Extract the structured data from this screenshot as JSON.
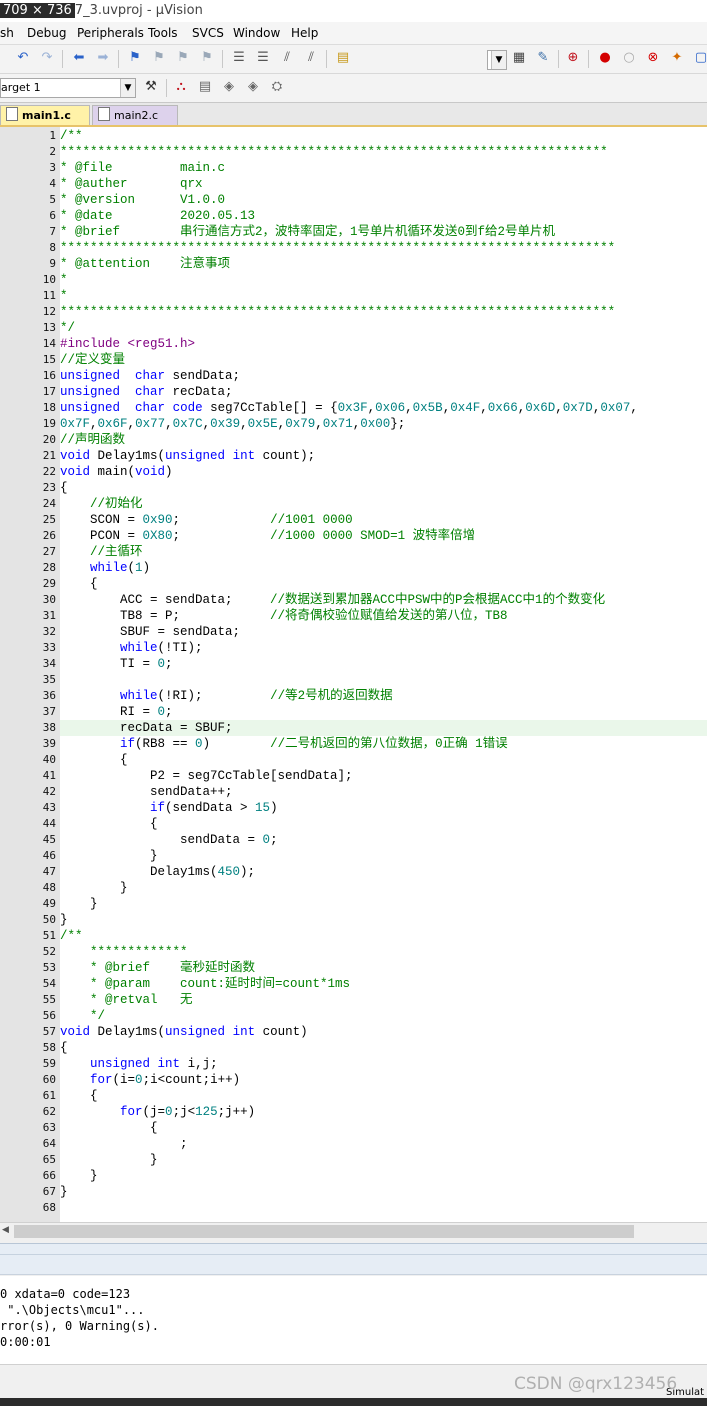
{
  "window": {
    "dimensions_label": "709 × 736",
    "title_tail": "7_3.uvproj - µVision"
  },
  "menu": [
    "sh",
    "Debug",
    "Peripherals",
    "Tools",
    "SVCS",
    "Window",
    "Help"
  ],
  "target": {
    "value": "arget 1"
  },
  "tabs": [
    {
      "label": "main1.c",
      "active": true
    },
    {
      "label": "main2.c",
      "active": false
    }
  ],
  "editor": {
    "current_line": 38,
    "lines": [
      [
        [
          "c",
          "/**"
        ]
      ],
      [
        [
          "c",
          "*************************************************************************"
        ]
      ],
      [
        [
          "c",
          "* @file         main.c"
        ]
      ],
      [
        [
          "c",
          "* @auther       qrx"
        ]
      ],
      [
        [
          "c",
          "* @version      V1.0.0"
        ]
      ],
      [
        [
          "c",
          "* @date         2020.05.13"
        ]
      ],
      [
        [
          "c",
          "* @brief        串行通信方式2，波特率固定，1号单片机循环发送0到f给2号单片机"
        ]
      ],
      [
        [
          "c",
          "**************************************************************************"
        ]
      ],
      [
        [
          "c",
          "* @attention    注意事项"
        ]
      ],
      [
        [
          "c",
          "*"
        ]
      ],
      [
        [
          "c",
          "*"
        ]
      ],
      [
        [
          "c",
          "**************************************************************************"
        ]
      ],
      [
        [
          "c",
          "*/"
        ]
      ],
      [
        [
          "p",
          "#include <reg51.h>"
        ]
      ],
      [
        [
          "c",
          "//定义变量"
        ]
      ],
      [
        [
          "k",
          "unsigned"
        ],
        [
          "",
          "  "
        ],
        [
          "k",
          "char"
        ],
        [
          "",
          " sendData;"
        ]
      ],
      [
        [
          "k",
          "unsigned"
        ],
        [
          "",
          "  "
        ],
        [
          "k",
          "char"
        ],
        [
          "",
          " recData;"
        ]
      ],
      [
        [
          "k",
          "unsigned"
        ],
        [
          "",
          "  "
        ],
        [
          "k",
          "char"
        ],
        [
          "",
          " "
        ],
        [
          "k",
          "code"
        ],
        [
          "",
          " seg7CcTable[] = {"
        ],
        [
          "n",
          "0x3F"
        ],
        [
          "",
          ","
        ],
        [
          "n",
          "0x06"
        ],
        [
          "",
          ","
        ],
        [
          "n",
          "0x5B"
        ],
        [
          "",
          ","
        ],
        [
          "n",
          "0x4F"
        ],
        [
          "",
          ","
        ],
        [
          "n",
          "0x66"
        ],
        [
          "",
          ","
        ],
        [
          "n",
          "0x6D"
        ],
        [
          "",
          ","
        ],
        [
          "n",
          "0x7D"
        ],
        [
          "",
          ","
        ],
        [
          "n",
          "0x07"
        ],
        [
          "",
          ","
        ]
      ],
      [
        [
          "n",
          "0x7F"
        ],
        [
          "",
          ","
        ],
        [
          "n",
          "0x6F"
        ],
        [
          "",
          ","
        ],
        [
          "n",
          "0x77"
        ],
        [
          "",
          ","
        ],
        [
          "n",
          "0x7C"
        ],
        [
          "",
          ","
        ],
        [
          "n",
          "0x39"
        ],
        [
          "",
          ","
        ],
        [
          "n",
          "0x5E"
        ],
        [
          "",
          ","
        ],
        [
          "n",
          "0x79"
        ],
        [
          "",
          ","
        ],
        [
          "n",
          "0x71"
        ],
        [
          "",
          ","
        ],
        [
          "n",
          "0x00"
        ],
        [
          "",
          "};"
        ]
      ],
      [
        [
          "c",
          "//声明函数"
        ]
      ],
      [
        [
          "k",
          "void"
        ],
        [
          "",
          " Delay1ms("
        ],
        [
          "k",
          "unsigned"
        ],
        [
          "",
          " "
        ],
        [
          "k",
          "int"
        ],
        [
          "",
          " count);"
        ]
      ],
      [
        [
          "k",
          "void"
        ],
        [
          "",
          " main("
        ],
        [
          "k",
          "void"
        ],
        [
          "",
          ")"
        ]
      ],
      [
        [
          "",
          "{"
        ]
      ],
      [
        [
          "",
          "    "
        ],
        [
          "c",
          "//初始化"
        ]
      ],
      [
        [
          "",
          "    SCON = "
        ],
        [
          "n",
          "0x90"
        ],
        [
          "",
          ";            "
        ],
        [
          "c",
          "//1001 0000"
        ]
      ],
      [
        [
          "",
          "    PCON = "
        ],
        [
          "n",
          "0X80"
        ],
        [
          "",
          ";            "
        ],
        [
          "c",
          "//1000 0000 SMOD=1 波特率倍增"
        ]
      ],
      [
        [
          "",
          "    "
        ],
        [
          "c",
          "//主循环"
        ]
      ],
      [
        [
          "",
          "    "
        ],
        [
          "k",
          "while"
        ],
        [
          "",
          "("
        ],
        [
          "n",
          "1"
        ],
        [
          "",
          ")"
        ]
      ],
      [
        [
          "",
          "    {"
        ]
      ],
      [
        [
          "",
          "        ACC = sendData;     "
        ],
        [
          "c",
          "//数据送到累加器ACC中PSW中的P会根据ACC中1的个数变化"
        ]
      ],
      [
        [
          "",
          "        TB8 = P;            "
        ],
        [
          "c",
          "//将奇偶校验位赋值给发送的第八位，TB8"
        ]
      ],
      [
        [
          "",
          "        SBUF = sendData;"
        ]
      ],
      [
        [
          "",
          "        "
        ],
        [
          "k",
          "while"
        ],
        [
          "",
          "(!TI);"
        ]
      ],
      [
        [
          "",
          "        TI = "
        ],
        [
          "n",
          "0"
        ],
        [
          "",
          ";"
        ]
      ],
      [
        [
          "",
          ""
        ]
      ],
      [
        [
          "",
          "        "
        ],
        [
          "k",
          "while"
        ],
        [
          "",
          "(!RI);         "
        ],
        [
          "c",
          "//等2号机的返回数据"
        ]
      ],
      [
        [
          "",
          "        RI = "
        ],
        [
          "n",
          "0"
        ],
        [
          "",
          ";"
        ]
      ],
      [
        [
          "",
          "        recData = SBUF;"
        ]
      ],
      [
        [
          "",
          "        "
        ],
        [
          "k",
          "if"
        ],
        [
          "",
          "(RB8 == "
        ],
        [
          "n",
          "0"
        ],
        [
          "",
          ")        "
        ],
        [
          "c",
          "//二号机返回的第八位数据，0正确 1错误"
        ]
      ],
      [
        [
          "",
          "        {"
        ]
      ],
      [
        [
          "",
          "            P2 = seg7CcTable[sendData];"
        ]
      ],
      [
        [
          "",
          "            sendData++;"
        ]
      ],
      [
        [
          "",
          "            "
        ],
        [
          "k",
          "if"
        ],
        [
          "",
          "(sendData > "
        ],
        [
          "n",
          "15"
        ],
        [
          "",
          ")"
        ]
      ],
      [
        [
          "",
          "            {"
        ]
      ],
      [
        [
          "",
          "                sendData = "
        ],
        [
          "n",
          "0"
        ],
        [
          "",
          ";"
        ]
      ],
      [
        [
          "",
          "            }"
        ]
      ],
      [
        [
          "",
          "            Delay1ms("
        ],
        [
          "n",
          "450"
        ],
        [
          "",
          ");"
        ]
      ],
      [
        [
          "",
          "        }"
        ]
      ],
      [
        [
          "",
          "    }"
        ]
      ],
      [
        [
          "",
          "}"
        ]
      ],
      [
        [
          "c",
          "/**"
        ]
      ],
      [
        [
          "c",
          "    *************"
        ]
      ],
      [
        [
          "c",
          "    * @brief    毫秒延时函数"
        ]
      ],
      [
        [
          "c",
          "    * @param    count:延时时间=count*1ms"
        ]
      ],
      [
        [
          "c",
          "    * @retval   无"
        ]
      ],
      [
        [
          "c",
          "    */"
        ]
      ],
      [
        [
          "k",
          "void"
        ],
        [
          "",
          " Delay1ms("
        ],
        [
          "k",
          "unsigned"
        ],
        [
          "",
          " "
        ],
        [
          "k",
          "int"
        ],
        [
          "",
          " count)"
        ]
      ],
      [
        [
          "",
          "{"
        ]
      ],
      [
        [
          "",
          "    "
        ],
        [
          "k",
          "unsigned"
        ],
        [
          "",
          " "
        ],
        [
          "k",
          "int"
        ],
        [
          "",
          " i,j;"
        ]
      ],
      [
        [
          "",
          "    "
        ],
        [
          "k",
          "for"
        ],
        [
          "",
          "(i="
        ],
        [
          "n",
          "0"
        ],
        [
          "",
          ";i<count;i++)"
        ]
      ],
      [
        [
          "",
          "    {"
        ]
      ],
      [
        [
          "",
          "        "
        ],
        [
          "k",
          "for"
        ],
        [
          "",
          "(j="
        ],
        [
          "n",
          "0"
        ],
        [
          "",
          ";j<"
        ],
        [
          "n",
          "125"
        ],
        [
          "",
          ";j++)"
        ]
      ],
      [
        [
          "",
          "            {"
        ]
      ],
      [
        [
          "",
          "                ;"
        ]
      ],
      [
        [
          "",
          "            }"
        ]
      ],
      [
        [
          "",
          "    }"
        ]
      ],
      [
        [
          "",
          "}"
        ]
      ],
      [
        [
          "",
          ""
        ]
      ]
    ]
  },
  "output": [
    "0 xdata=0 code=123",
    " \".\\Objects\\mcu1\"...",
    "rror(s), 0 Warning(s).",
    "0:00:01"
  ],
  "status": {
    "mode": "Simulat"
  },
  "watermark": "CSDN @qrx123456",
  "icons": [
    "undo-icon",
    "redo-icon",
    "back-icon",
    "forward-icon",
    "bookmark-icon",
    "indent-icon",
    "unindent-icon",
    "comment-icon",
    "uncomment-icon",
    "open-file-icon",
    "search-icon",
    "debug-icon",
    "breakpoint-icon",
    "kill-breakpoint-icon",
    "build-icon",
    "rebuild-icon",
    "options-icon",
    "manage-icon"
  ]
}
